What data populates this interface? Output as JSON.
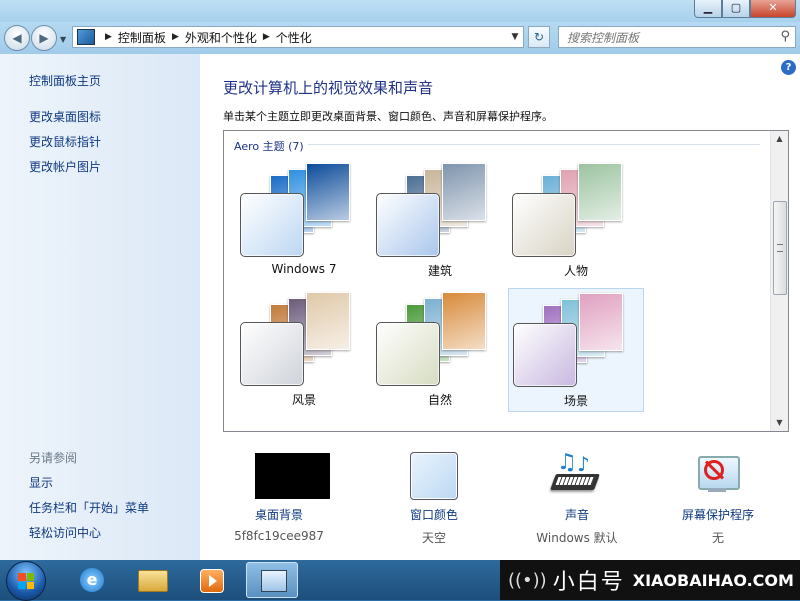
{
  "address": {
    "crumbs": [
      "控制面板",
      "外观和个性化",
      "个性化"
    ],
    "search_placeholder": "搜索控制面板"
  },
  "sidebar": {
    "home": "控制面板主页",
    "links": [
      "更改桌面图标",
      "更改鼠标指针",
      "更改帐户图片"
    ],
    "see_also_title": "另请参阅",
    "see_also": [
      "显示",
      "任务栏和「开始」菜单",
      "轻松访问中心"
    ]
  },
  "main": {
    "title": "更改计算机上的视觉效果和声音",
    "description": "单击某个主题立即更改桌面背景、窗口颜色、声音和屏幕保护程序。",
    "group_header": "Aero 主题 (7)",
    "themes": [
      {
        "name": "Windows 7",
        "selected": false,
        "tint": "#bcd7f2",
        "colors": [
          "#1a6cc8",
          "#2f8fe0",
          "#0c4b9a"
        ]
      },
      {
        "name": "建筑",
        "selected": false,
        "tint": "#a9c6ec",
        "colors": [
          "#4a6d92",
          "#c8b59a",
          "#7e94ad"
        ]
      },
      {
        "name": "人物",
        "selected": false,
        "tint": "#d8d3c4",
        "colors": [
          "#6ab0d8",
          "#e0a0b0",
          "#9cc3a0"
        ]
      },
      {
        "name": "风景",
        "selected": false,
        "tint": "#cfd3da",
        "colors": [
          "#c27a3a",
          "#6a5a7a",
          "#e0c8a8"
        ]
      },
      {
        "name": "自然",
        "selected": false,
        "tint": "#d6dcc0",
        "colors": [
          "#4a9a3a",
          "#7ab0d0",
          "#d88a3a"
        ]
      },
      {
        "name": "场景",
        "selected": true,
        "tint": "#c8b8e0",
        "colors": [
          "#a070c0",
          "#7ec0d8",
          "#e0a0c0"
        ]
      }
    ]
  },
  "bottom": {
    "desktop_bg": {
      "label": "桌面背景",
      "value": "5f8fc19cee987"
    },
    "window_color": {
      "label": "窗口颜色",
      "value": "天空"
    },
    "sound": {
      "label": "声音",
      "value": "Windows 默认"
    },
    "screensaver": {
      "label": "屏幕保护程序",
      "value": "无"
    }
  },
  "watermark": {
    "text1": "小白号",
    "text2": "XIAOBAIHAO.COM"
  }
}
